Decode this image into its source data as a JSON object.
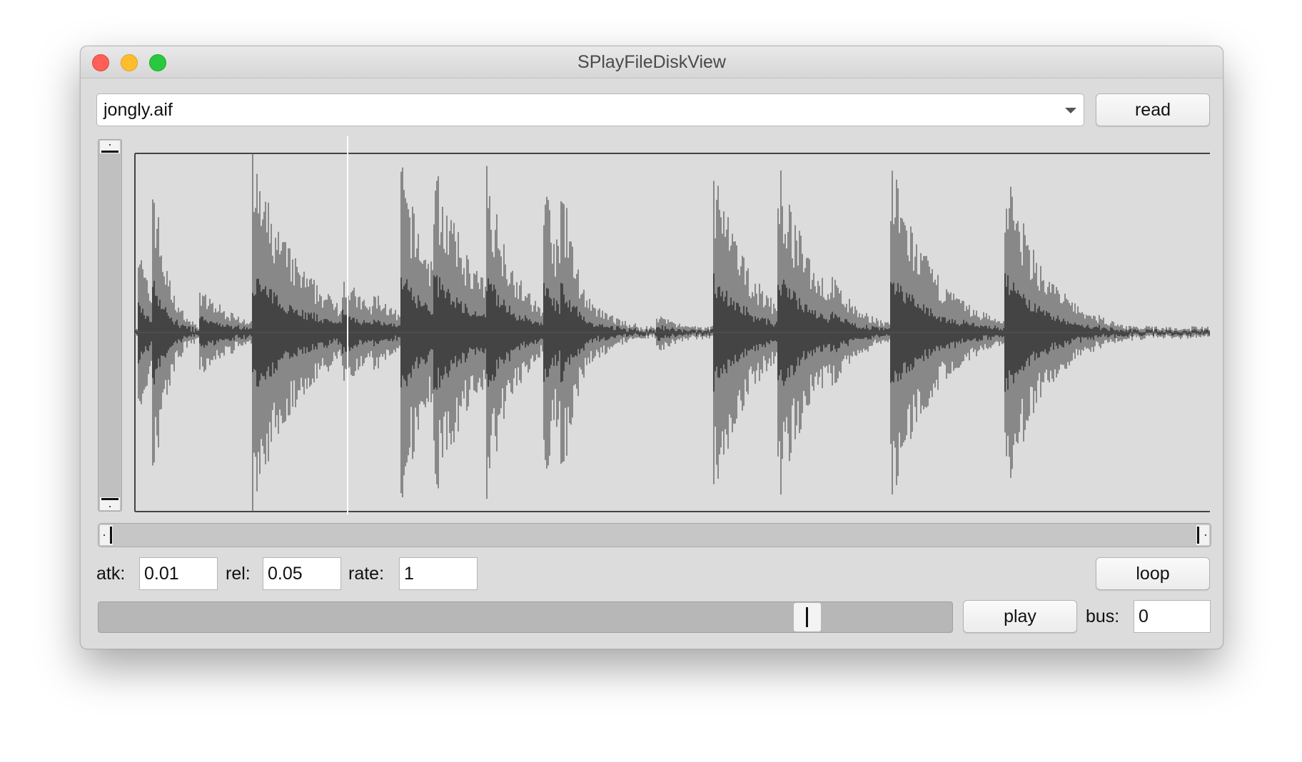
{
  "window": {
    "title": "SPlayFileDiskView"
  },
  "file_selector": {
    "selected": "jongly.aif"
  },
  "buttons": {
    "read": "read",
    "loop": "loop",
    "play": "play"
  },
  "params": {
    "atk": {
      "label": "atk:",
      "value": "0.01"
    },
    "rel": {
      "label": "rel:",
      "value": "0.05"
    },
    "rate": {
      "label": "rate:",
      "value": "1"
    },
    "bus": {
      "label": "bus:",
      "value": "0"
    }
  },
  "playback_position": 0.83,
  "colors": {
    "waveform_peak": "#888888",
    "waveform_rms": "#444444",
    "waveform_bg": "#dcdcdc",
    "cursor": "#ffffff"
  }
}
